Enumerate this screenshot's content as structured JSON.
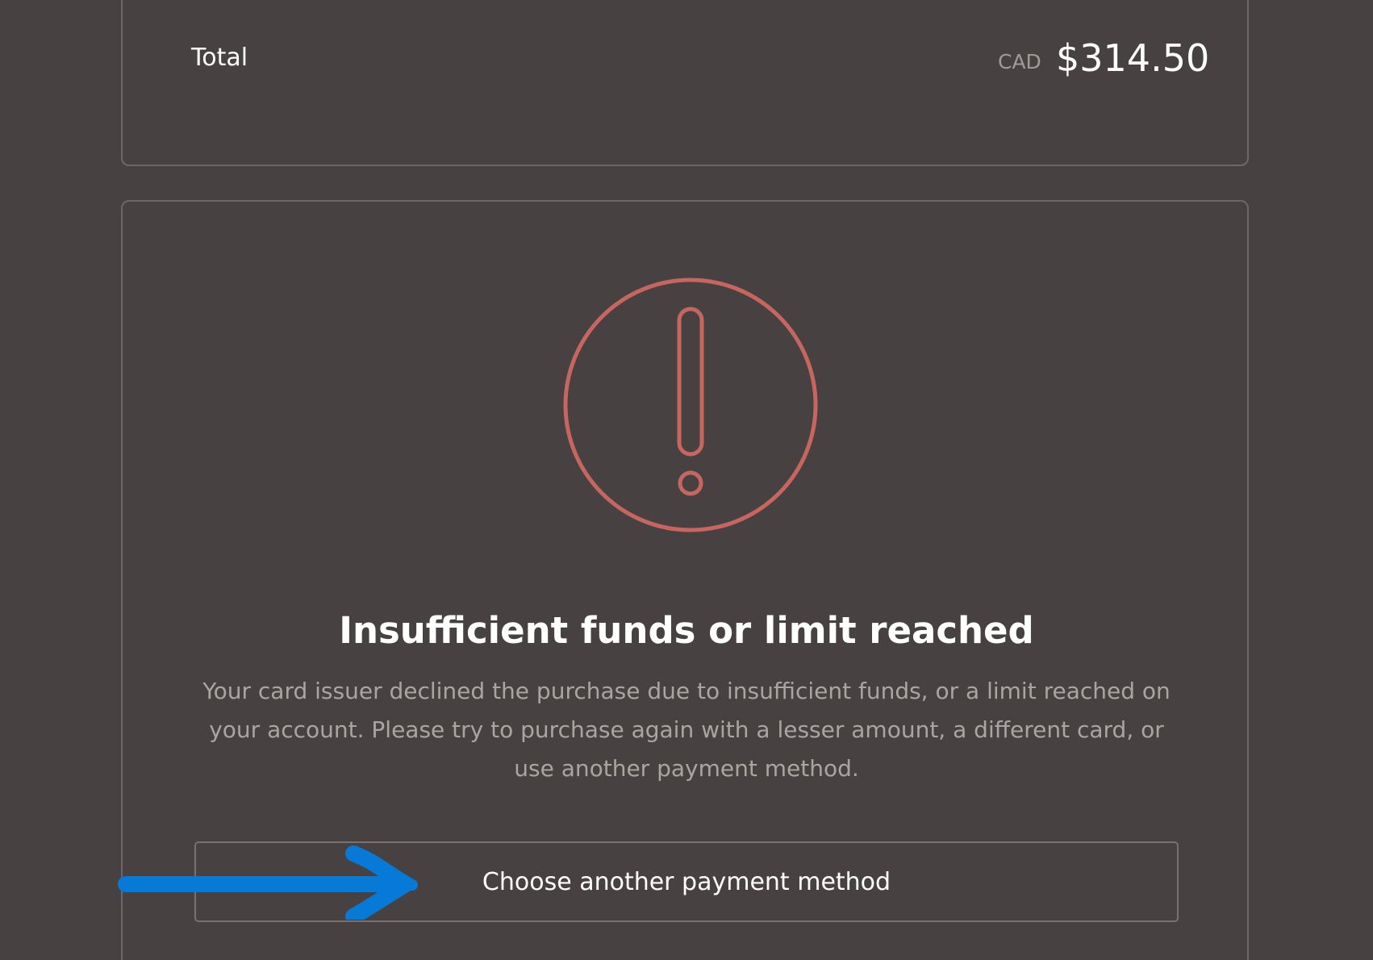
{
  "summary": {
    "total_label": "Total",
    "currency": "CAD",
    "amount": "$314.50"
  },
  "error": {
    "icon": "exclamation-circle-icon",
    "title": "Insufficient funds or limit reached",
    "message": "Your card issuer declined the purchase due to insufficient funds, or a limit reached on your account. Please try to purchase again with a lesser amount, a different card, or use another payment method.",
    "button_label": "Choose another payment method"
  },
  "annotation": {
    "icon": "arrow-right-icon",
    "color": "#0779d7"
  },
  "colors": {
    "background": "#474241",
    "card_border": "#6d6866",
    "alert": "#c76560",
    "text_primary": "#ffffff",
    "text_secondary": "#aaa5a3"
  }
}
